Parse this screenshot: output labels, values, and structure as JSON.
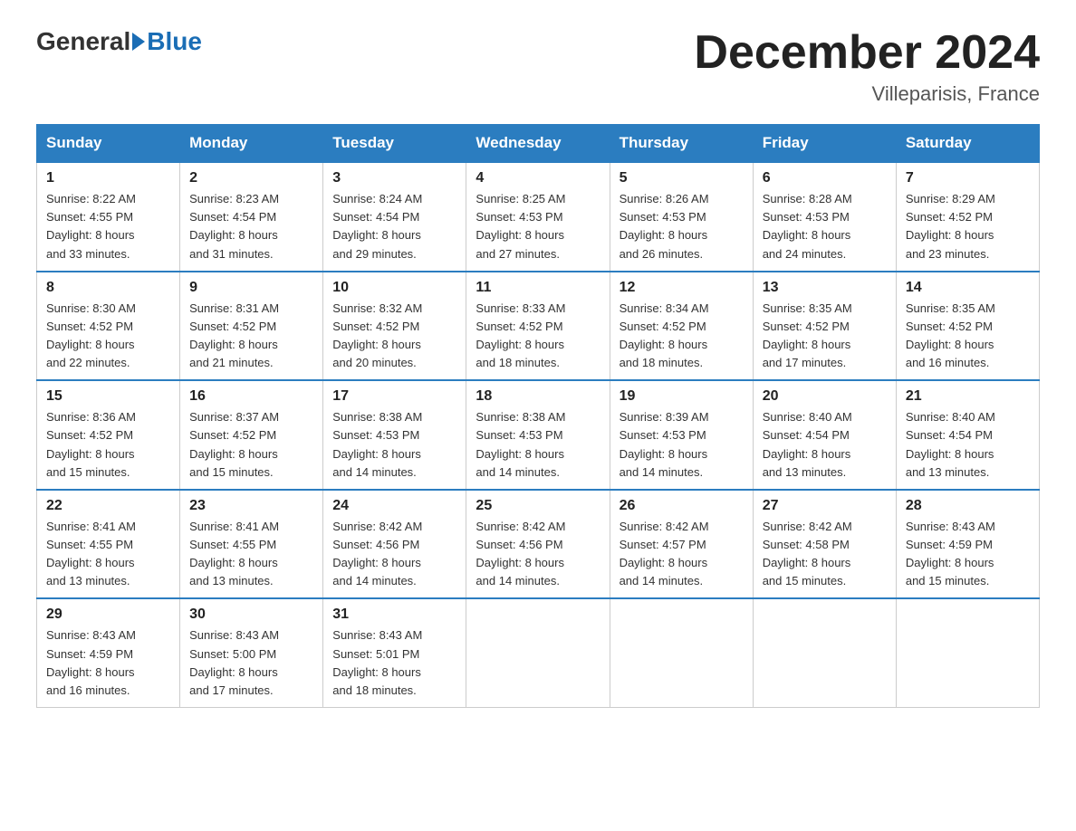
{
  "logo": {
    "general": "General",
    "blue": "Blue"
  },
  "title": "December 2024",
  "location": "Villeparisis, France",
  "days_of_week": [
    "Sunday",
    "Monday",
    "Tuesday",
    "Wednesday",
    "Thursday",
    "Friday",
    "Saturday"
  ],
  "weeks": [
    [
      {
        "day": "1",
        "info": "Sunrise: 8:22 AM\nSunset: 4:55 PM\nDaylight: 8 hours\nand 33 minutes."
      },
      {
        "day": "2",
        "info": "Sunrise: 8:23 AM\nSunset: 4:54 PM\nDaylight: 8 hours\nand 31 minutes."
      },
      {
        "day": "3",
        "info": "Sunrise: 8:24 AM\nSunset: 4:54 PM\nDaylight: 8 hours\nand 29 minutes."
      },
      {
        "day": "4",
        "info": "Sunrise: 8:25 AM\nSunset: 4:53 PM\nDaylight: 8 hours\nand 27 minutes."
      },
      {
        "day": "5",
        "info": "Sunrise: 8:26 AM\nSunset: 4:53 PM\nDaylight: 8 hours\nand 26 minutes."
      },
      {
        "day": "6",
        "info": "Sunrise: 8:28 AM\nSunset: 4:53 PM\nDaylight: 8 hours\nand 24 minutes."
      },
      {
        "day": "7",
        "info": "Sunrise: 8:29 AM\nSunset: 4:52 PM\nDaylight: 8 hours\nand 23 minutes."
      }
    ],
    [
      {
        "day": "8",
        "info": "Sunrise: 8:30 AM\nSunset: 4:52 PM\nDaylight: 8 hours\nand 22 minutes."
      },
      {
        "day": "9",
        "info": "Sunrise: 8:31 AM\nSunset: 4:52 PM\nDaylight: 8 hours\nand 21 minutes."
      },
      {
        "day": "10",
        "info": "Sunrise: 8:32 AM\nSunset: 4:52 PM\nDaylight: 8 hours\nand 20 minutes."
      },
      {
        "day": "11",
        "info": "Sunrise: 8:33 AM\nSunset: 4:52 PM\nDaylight: 8 hours\nand 18 minutes."
      },
      {
        "day": "12",
        "info": "Sunrise: 8:34 AM\nSunset: 4:52 PM\nDaylight: 8 hours\nand 18 minutes."
      },
      {
        "day": "13",
        "info": "Sunrise: 8:35 AM\nSunset: 4:52 PM\nDaylight: 8 hours\nand 17 minutes."
      },
      {
        "day": "14",
        "info": "Sunrise: 8:35 AM\nSunset: 4:52 PM\nDaylight: 8 hours\nand 16 minutes."
      }
    ],
    [
      {
        "day": "15",
        "info": "Sunrise: 8:36 AM\nSunset: 4:52 PM\nDaylight: 8 hours\nand 15 minutes."
      },
      {
        "day": "16",
        "info": "Sunrise: 8:37 AM\nSunset: 4:52 PM\nDaylight: 8 hours\nand 15 minutes."
      },
      {
        "day": "17",
        "info": "Sunrise: 8:38 AM\nSunset: 4:53 PM\nDaylight: 8 hours\nand 14 minutes."
      },
      {
        "day": "18",
        "info": "Sunrise: 8:38 AM\nSunset: 4:53 PM\nDaylight: 8 hours\nand 14 minutes."
      },
      {
        "day": "19",
        "info": "Sunrise: 8:39 AM\nSunset: 4:53 PM\nDaylight: 8 hours\nand 14 minutes."
      },
      {
        "day": "20",
        "info": "Sunrise: 8:40 AM\nSunset: 4:54 PM\nDaylight: 8 hours\nand 13 minutes."
      },
      {
        "day": "21",
        "info": "Sunrise: 8:40 AM\nSunset: 4:54 PM\nDaylight: 8 hours\nand 13 minutes."
      }
    ],
    [
      {
        "day": "22",
        "info": "Sunrise: 8:41 AM\nSunset: 4:55 PM\nDaylight: 8 hours\nand 13 minutes."
      },
      {
        "day": "23",
        "info": "Sunrise: 8:41 AM\nSunset: 4:55 PM\nDaylight: 8 hours\nand 13 minutes."
      },
      {
        "day": "24",
        "info": "Sunrise: 8:42 AM\nSunset: 4:56 PM\nDaylight: 8 hours\nand 14 minutes."
      },
      {
        "day": "25",
        "info": "Sunrise: 8:42 AM\nSunset: 4:56 PM\nDaylight: 8 hours\nand 14 minutes."
      },
      {
        "day": "26",
        "info": "Sunrise: 8:42 AM\nSunset: 4:57 PM\nDaylight: 8 hours\nand 14 minutes."
      },
      {
        "day": "27",
        "info": "Sunrise: 8:42 AM\nSunset: 4:58 PM\nDaylight: 8 hours\nand 15 minutes."
      },
      {
        "day": "28",
        "info": "Sunrise: 8:43 AM\nSunset: 4:59 PM\nDaylight: 8 hours\nand 15 minutes."
      }
    ],
    [
      {
        "day": "29",
        "info": "Sunrise: 8:43 AM\nSunset: 4:59 PM\nDaylight: 8 hours\nand 16 minutes."
      },
      {
        "day": "30",
        "info": "Sunrise: 8:43 AM\nSunset: 5:00 PM\nDaylight: 8 hours\nand 17 minutes."
      },
      {
        "day": "31",
        "info": "Sunrise: 8:43 AM\nSunset: 5:01 PM\nDaylight: 8 hours\nand 18 minutes."
      },
      {
        "day": "",
        "info": ""
      },
      {
        "day": "",
        "info": ""
      },
      {
        "day": "",
        "info": ""
      },
      {
        "day": "",
        "info": ""
      }
    ]
  ]
}
